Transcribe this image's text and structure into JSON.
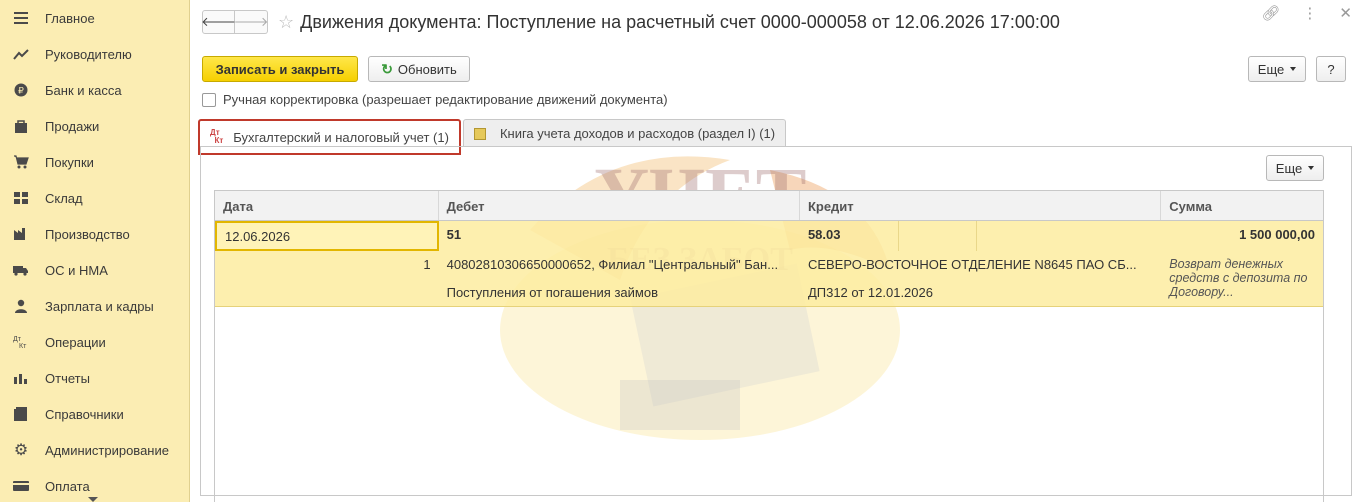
{
  "sidebar": {
    "items": [
      {
        "label": "Главное",
        "icon": "menu-icon"
      },
      {
        "label": "Руководителю",
        "icon": "trend-icon"
      },
      {
        "label": "Банк и касса",
        "icon": "coin-icon"
      },
      {
        "label": "Продажи",
        "icon": "bag-icon"
      },
      {
        "label": "Покупки",
        "icon": "cart-icon"
      },
      {
        "label": "Склад",
        "icon": "warehouse-icon"
      },
      {
        "label": "Производство",
        "icon": "factory-icon"
      },
      {
        "label": "ОС и НМА",
        "icon": "truck-icon"
      },
      {
        "label": "Зарплата и кадры",
        "icon": "person-icon"
      },
      {
        "label": "Операции",
        "icon": "dt-kt-icon"
      },
      {
        "label": "Отчеты",
        "icon": "bar-chart-icon"
      },
      {
        "label": "Справочники",
        "icon": "book-icon"
      },
      {
        "label": "Администрирование",
        "icon": "gear-icon"
      },
      {
        "label": "Оплата",
        "icon": "card-icon"
      }
    ]
  },
  "header": {
    "title": "Движения документа: Поступление на расчетный счет 0000-000058 от 12.06.2026 17:00:00"
  },
  "toolbar": {
    "save_close_label": "Записать и закрыть",
    "refresh_label": "Обновить",
    "more_label": "Еще",
    "help_label": "?"
  },
  "manual": {
    "label": "Ручная корректировка (разрешает редактирование движений документа)"
  },
  "tabs": [
    {
      "label": "Бухгалтерский и налоговый учет (1)",
      "icon_text": "Дт Кт"
    },
    {
      "label": "Книга учета доходов и расходов (раздел I) (1)"
    }
  ],
  "panel": {
    "more_label": "Еще"
  },
  "table": {
    "headers": {
      "date": "Дата",
      "debit": "Дебет",
      "credit": "Кредит",
      "sum": "Сумма"
    },
    "row": {
      "date": "12.06.2026",
      "line_no": "1",
      "debit_account": "51",
      "debit_sub1": "40802810306650000652, Филиал \"Центральный\" Бан...",
      "debit_sub2": "Поступления от погашения займов",
      "credit_account": "58.03",
      "credit_sub1": "СЕВЕРО-ВОСТОЧНОЕ ОТДЕЛЕНИЕ N8645 ПАО СБ...",
      "credit_sub2": "ДП312 от 12.01.2026",
      "sum": "1 500 000,00",
      "comment": "Возврат денежных средств с депозита по Договору..."
    }
  },
  "watermark": {
    "line1": "УЧЕТ",
    "line2": "БЕЗ ЗАБОТ"
  },
  "colors": {
    "sidebar_bg": "#fbedb3",
    "primary_btn": "#f6d000",
    "row_bg": "#fdeca0",
    "active_tab_border": "#c0392b"
  }
}
